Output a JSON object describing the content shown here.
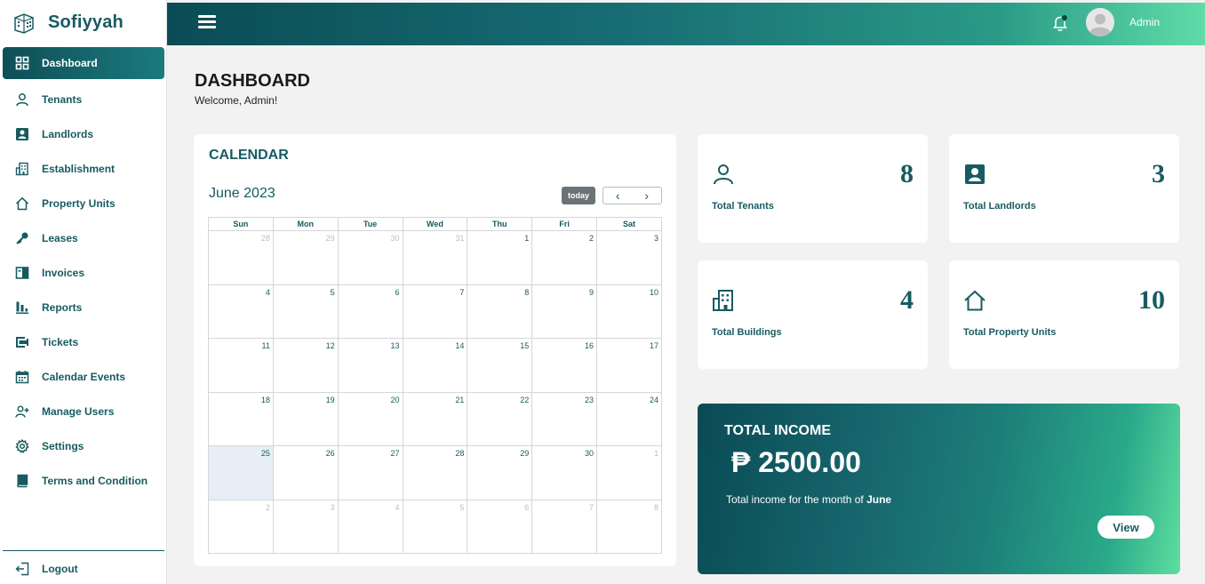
{
  "brand": {
    "name": "Sofiyyah"
  },
  "sidebar": {
    "items": [
      {
        "label": "Dashboard",
        "icon": "grid-icon"
      },
      {
        "label": "Tenants",
        "icon": "user-icon"
      },
      {
        "label": "Landlords",
        "icon": "user-square-icon"
      },
      {
        "label": "Establishment",
        "icon": "building-icon"
      },
      {
        "label": "Property Units",
        "icon": "home-icon"
      },
      {
        "label": "Leases",
        "icon": "key-icon"
      },
      {
        "label": "Invoices",
        "icon": "invoice-icon"
      },
      {
        "label": "Reports",
        "icon": "bar-chart-icon"
      },
      {
        "label": "Tickets",
        "icon": "ticket-icon"
      },
      {
        "label": "Calendar Events",
        "icon": "calendar-icon"
      },
      {
        "label": "Manage Users",
        "icon": "user-plus-icon"
      },
      {
        "label": "Settings",
        "icon": "gear-icon"
      },
      {
        "label": "Terms and Condition",
        "icon": "book-icon"
      }
    ],
    "logout_label": "Logout"
  },
  "topbar": {
    "user_name": "Admin"
  },
  "header": {
    "title": "DASHBOARD",
    "welcome": "Welcome, Admin!"
  },
  "calendar": {
    "heading": "CALENDAR",
    "month_label": "June 2023",
    "today_label": "today",
    "prev_label": "‹",
    "next_label": "›",
    "weekdays": [
      "Sun",
      "Mon",
      "Tue",
      "Wed",
      "Thu",
      "Fri",
      "Sat"
    ],
    "weeks": [
      [
        "28",
        "29",
        "30",
        "31",
        "1",
        "2",
        "3"
      ],
      [
        "4",
        "5",
        "6",
        "7",
        "8",
        "9",
        "10"
      ],
      [
        "11",
        "12",
        "13",
        "14",
        "15",
        "16",
        "17"
      ],
      [
        "18",
        "19",
        "20",
        "21",
        "22",
        "23",
        "24"
      ],
      [
        "25",
        "26",
        "27",
        "28",
        "29",
        "30",
        "1"
      ],
      [
        "2",
        "3",
        "4",
        "5",
        "6",
        "7",
        "8"
      ]
    ]
  },
  "stats": {
    "tenants": {
      "value": "8",
      "label": "Total Tenants"
    },
    "landlords": {
      "value": "3",
      "label": "Total Landlords"
    },
    "buildings": {
      "value": "4",
      "label": "Total Buildings"
    },
    "units": {
      "value": "10",
      "label": "Total Property Units"
    }
  },
  "income": {
    "title": "TOTAL INCOME",
    "amount": "₱ 2500.00",
    "subtitle_prefix": "Total income for the month of",
    "month": "June",
    "view_label": "View"
  },
  "colors": {
    "primary": "#175b61",
    "accent_end": "#5fdca8",
    "today_cell": "#e7eef6"
  }
}
